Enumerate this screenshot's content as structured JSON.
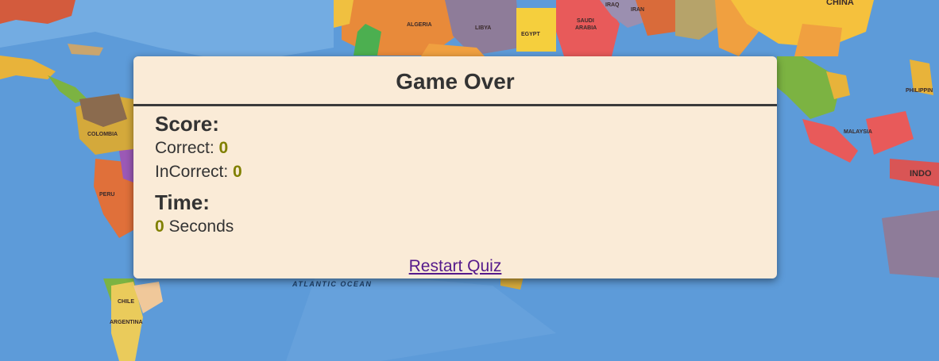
{
  "background": {
    "labels": {
      "algeria": "ALGERIA",
      "libya": "LIBYA",
      "egypt": "EGYPT",
      "saudi": "SAUDI",
      "arabia": "ARABIA",
      "iraq": "IRAQ",
      "iran": "IRAN",
      "china": "CHINA",
      "colombia": "COLOMBIA",
      "peru": "PERU",
      "chile": "CHILE",
      "argentina": "ARGENTINA",
      "malaysia": "MALAYSIA",
      "indo": "INDO",
      "philippines": "PHILIPPIN",
      "atlantic": "ATLANTIC OCEAN"
    }
  },
  "modal": {
    "title": "Game Over",
    "score_heading": "Score:",
    "correct_label": "Correct: ",
    "correct_value": "0",
    "incorrect_label": "InCorrect: ",
    "incorrect_value": "0",
    "time_heading": "Time:",
    "time_value": "0",
    "time_unit": " Seconds",
    "restart_label": "Restart Quiz"
  },
  "colors": {
    "modal_bg": "#faebd7",
    "text": "#333333",
    "value": "#808000",
    "link": "#551a8b",
    "ocean": "#5d9bd9"
  }
}
